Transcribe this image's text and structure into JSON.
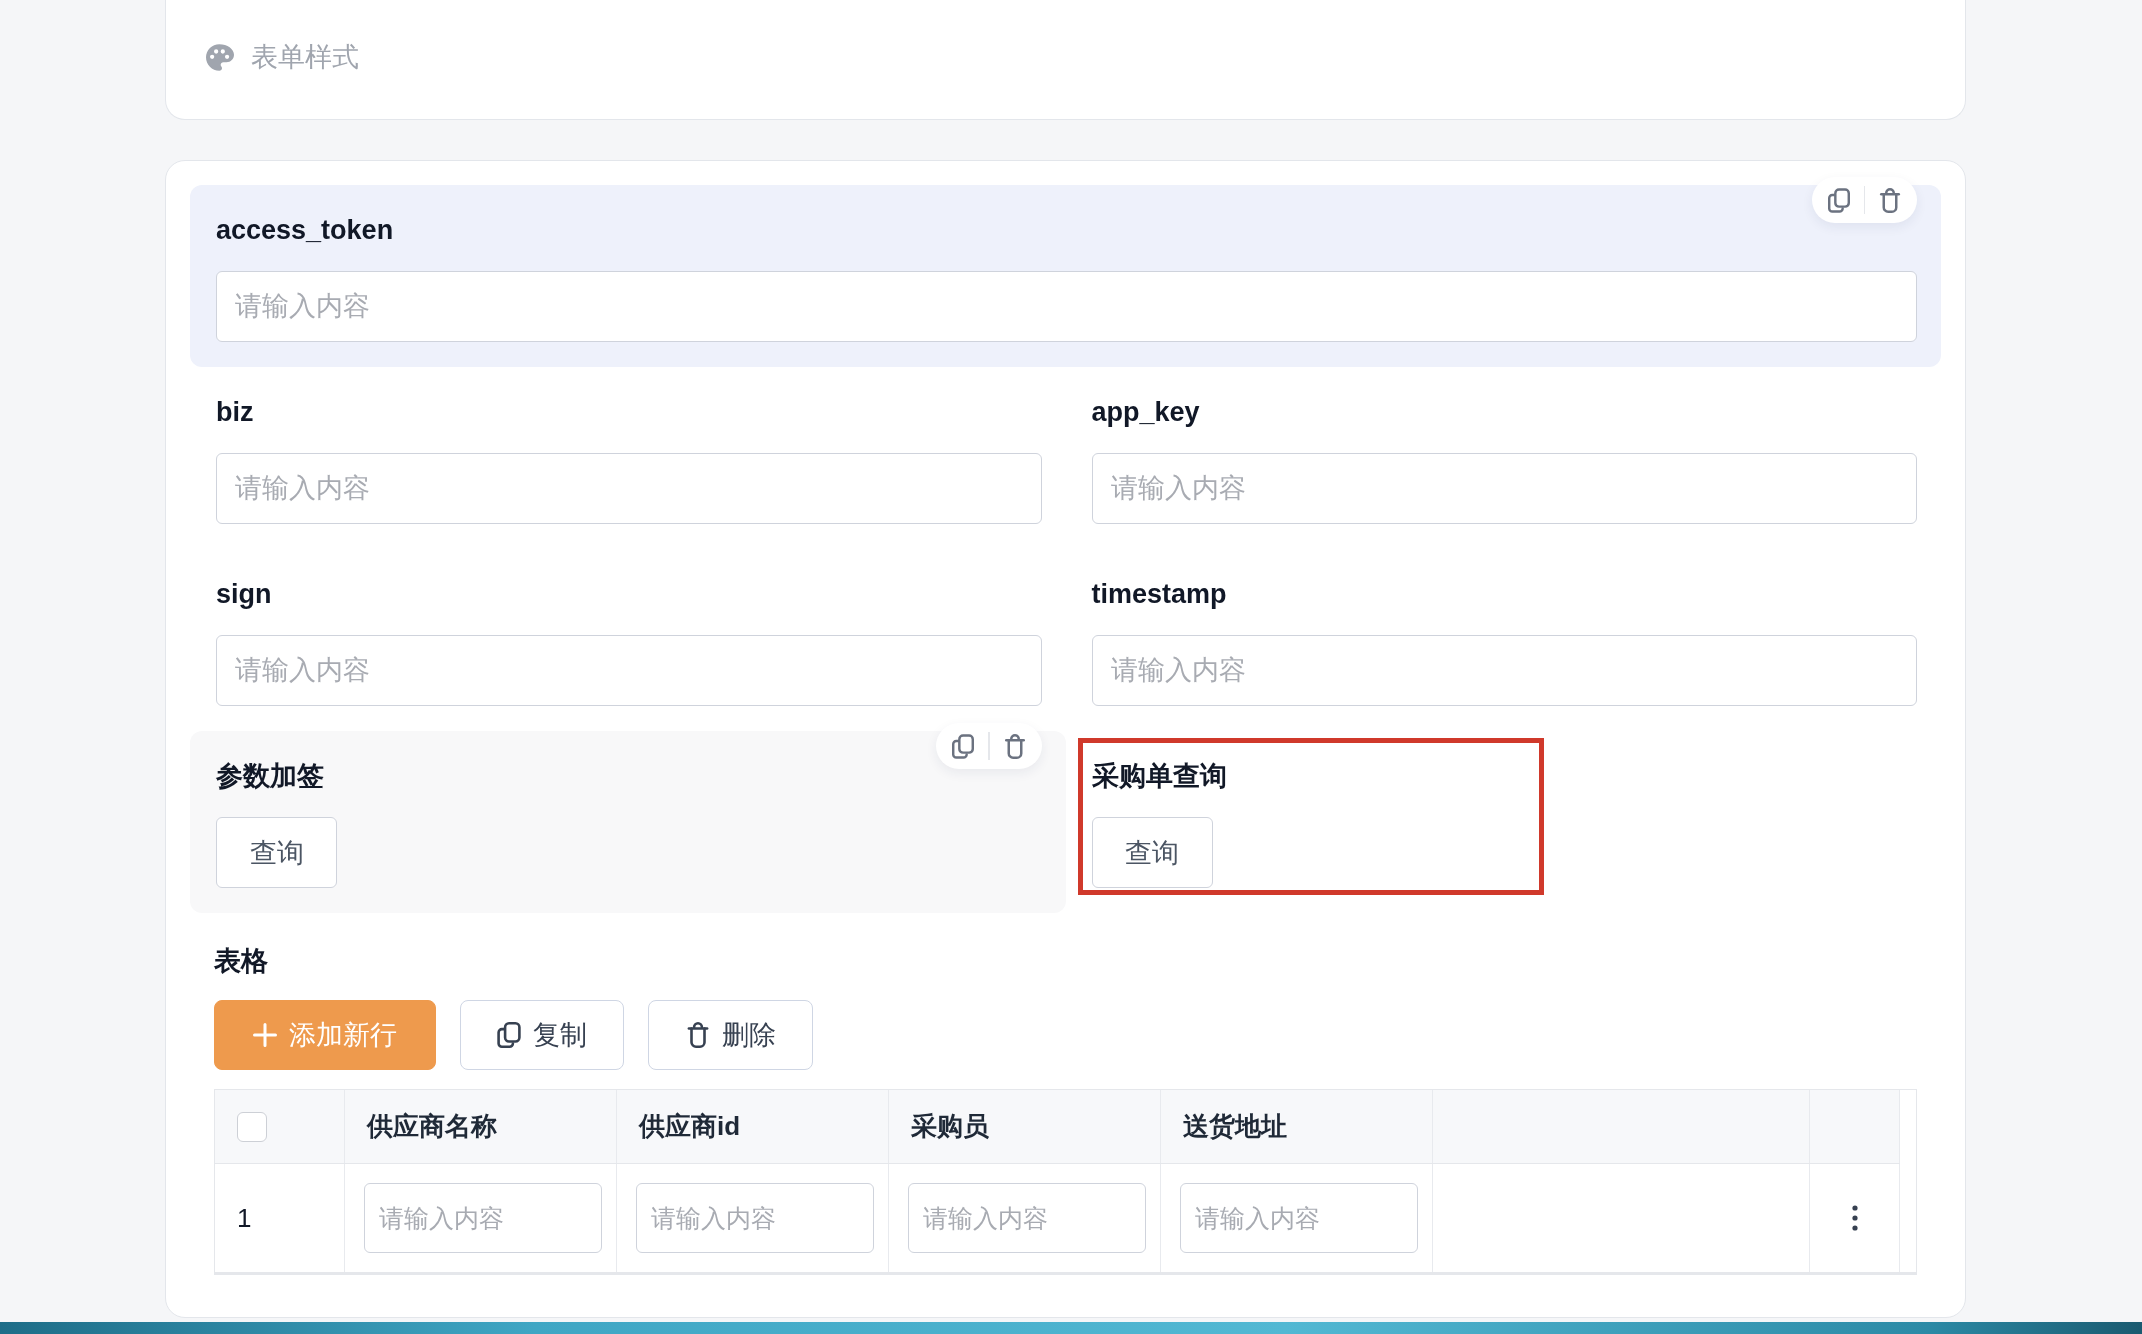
{
  "style_menu": {
    "items": [
      {
        "label": "表单样式"
      }
    ]
  },
  "form": {
    "rows": [
      {
        "fields": [
          {
            "kind": "input",
            "label": "access_token",
            "placeholder": "请输入内容",
            "selected": true,
            "hovered": false,
            "annotated": false
          }
        ]
      },
      {
        "fields": [
          {
            "kind": "input",
            "label": "biz",
            "placeholder": "请输入内容",
            "selected": false,
            "hovered": false,
            "annotated": false
          },
          {
            "kind": "input",
            "label": "app_key",
            "placeholder": "请输入内容",
            "selected": false,
            "hovered": false,
            "annotated": false
          }
        ]
      },
      {
        "fields": [
          {
            "kind": "input",
            "label": "sign",
            "placeholder": "请输入内容",
            "selected": false,
            "hovered": false,
            "annotated": false
          },
          {
            "kind": "input",
            "label": "timestamp",
            "placeholder": "请输入内容",
            "selected": false,
            "hovered": false,
            "annotated": false
          }
        ]
      },
      {
        "fields": [
          {
            "kind": "button",
            "label": "参数加签",
            "button": "查询",
            "selected": false,
            "hovered": true,
            "annotated": false
          },
          {
            "kind": "button",
            "label": "采购单查询",
            "button": "查询",
            "selected": false,
            "hovered": false,
            "annotated": true
          }
        ]
      }
    ]
  },
  "table_section": {
    "label": "表格",
    "actions": [
      {
        "kind": "add",
        "label": "添加新行"
      },
      {
        "kind": "copy",
        "label": "复制"
      },
      {
        "kind": "delete",
        "label": "删除"
      }
    ],
    "table": {
      "header_checked": false,
      "columns": [
        "供应商名称",
        "供应商id",
        "采购员",
        "送货地址"
      ],
      "rows": [
        {
          "number": "1",
          "cells": [
            {
              "placeholder": "请输入内容"
            },
            {
              "placeholder": "请输入内容"
            },
            {
              "placeholder": "请输入内容"
            },
            {
              "placeholder": "请输入内容"
            }
          ]
        }
      ]
    }
  }
}
